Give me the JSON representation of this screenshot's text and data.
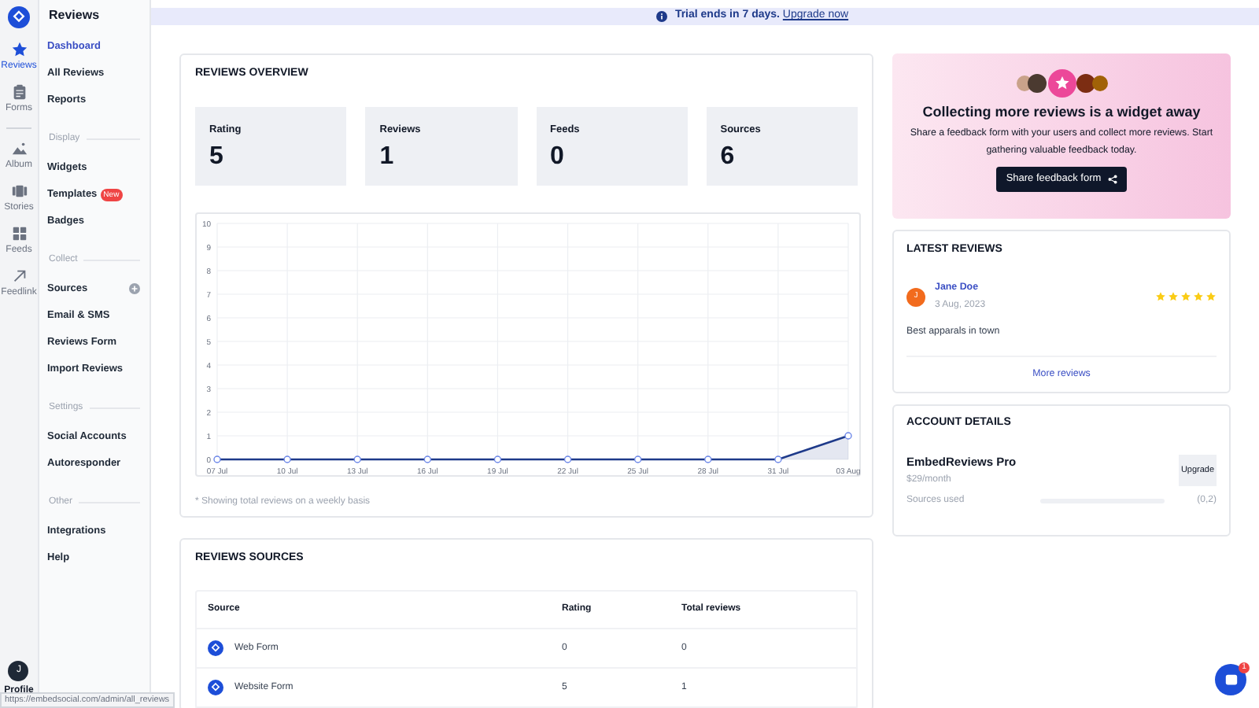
{
  "rail": {
    "items": [
      {
        "label": "Reviews",
        "selected": true
      },
      {
        "label": "Forms",
        "selected": false
      },
      {
        "label": "Album",
        "selected": false
      },
      {
        "label": "Stories",
        "selected": false
      },
      {
        "label": "Feeds",
        "selected": false
      },
      {
        "label": "Feedlink",
        "selected": false
      }
    ],
    "profile": {
      "initial": "J",
      "label": "Profile"
    }
  },
  "sidebar": {
    "title": "Reviews",
    "sections": [
      {
        "items": [
          {
            "label": "Dashboard",
            "selected": true
          },
          {
            "label": "All Reviews",
            "selected": false
          },
          {
            "label": "Reports",
            "selected": false
          }
        ]
      },
      {
        "heading": "Display",
        "items": [
          {
            "label": "Widgets",
            "selected": false
          },
          {
            "label": "Templates",
            "badge": "New",
            "selected": false
          },
          {
            "label": "Badges",
            "selected": false
          }
        ]
      },
      {
        "heading": "Collect",
        "items": [
          {
            "label": "Sources",
            "has_action": true,
            "selected": false
          },
          {
            "label": "Email & SMS",
            "selected": false
          },
          {
            "label": "Reviews Form",
            "selected": false
          },
          {
            "label": "Import Reviews",
            "selected": false
          }
        ]
      },
      {
        "heading": "Settings",
        "items": [
          {
            "label": "Social Accounts",
            "selected": false
          },
          {
            "label": "Autoresponder",
            "selected": false
          }
        ]
      },
      {
        "heading": "Other",
        "items": [
          {
            "label": "Integrations",
            "selected": false
          },
          {
            "label": "Help",
            "selected": false
          }
        ]
      }
    ]
  },
  "banner": {
    "text": "Trial ends in 7 days.",
    "link": "Upgrade now"
  },
  "overview": {
    "title": "REVIEWS OVERVIEW",
    "stats": [
      {
        "label": "Rating",
        "value": "5"
      },
      {
        "label": "Reviews",
        "value": "1"
      },
      {
        "label": "Feeds",
        "value": "0"
      },
      {
        "label": "Sources",
        "value": "6"
      }
    ],
    "chart_data": {
      "type": "area",
      "categories": [
        "07 Jul",
        "10 Jul",
        "13 Jul",
        "16 Jul",
        "19 Jul",
        "22 Jul",
        "25 Jul",
        "28 Jul",
        "31 Jul",
        "03 Aug"
      ],
      "grid": true,
      "series": [
        {
          "color": "#1e3a8a",
          "values": [
            0,
            0,
            0,
            0,
            0,
            0,
            0,
            0,
            0,
            1
          ]
        }
      ],
      "ylim": [
        0,
        10
      ],
      "yticks": [
        0,
        1,
        2,
        3,
        4,
        5,
        6,
        7,
        8,
        9,
        10
      ]
    },
    "note": "* Showing total reviews on a weekly basis"
  },
  "sources": {
    "title": "REVIEWS SOURCES",
    "columns": [
      "Source",
      "Rating",
      "Total reviews"
    ],
    "rows": [
      {
        "source": "Web Form",
        "rating": "0",
        "total": "0"
      },
      {
        "source": "Website Form",
        "rating": "5",
        "total": "1"
      }
    ]
  },
  "promo": {
    "title": "Collecting more reviews is a widget away",
    "text": "Share a feedback form with your users and collect more reviews. Start gathering valuable feedback today.",
    "button": "Share feedback form"
  },
  "latest": {
    "title": "LATEST REVIEWS",
    "reviews": [
      {
        "initial": "J",
        "name": "Jane Doe",
        "date": "3 Aug, 2023",
        "stars": 5,
        "text": "Best apparals in town"
      }
    ],
    "more": "More reviews"
  },
  "account": {
    "title": "ACCOUNT DETAILS",
    "plan": "EmbedReviews Pro",
    "price": "$29/month",
    "button": "Upgrade",
    "usage_label": "Sources used",
    "level": 0,
    "usage": "(0,2)"
  },
  "chat": {
    "badge": "1"
  },
  "status_url": "https://embedsocial.com/admin/all_reviews"
}
